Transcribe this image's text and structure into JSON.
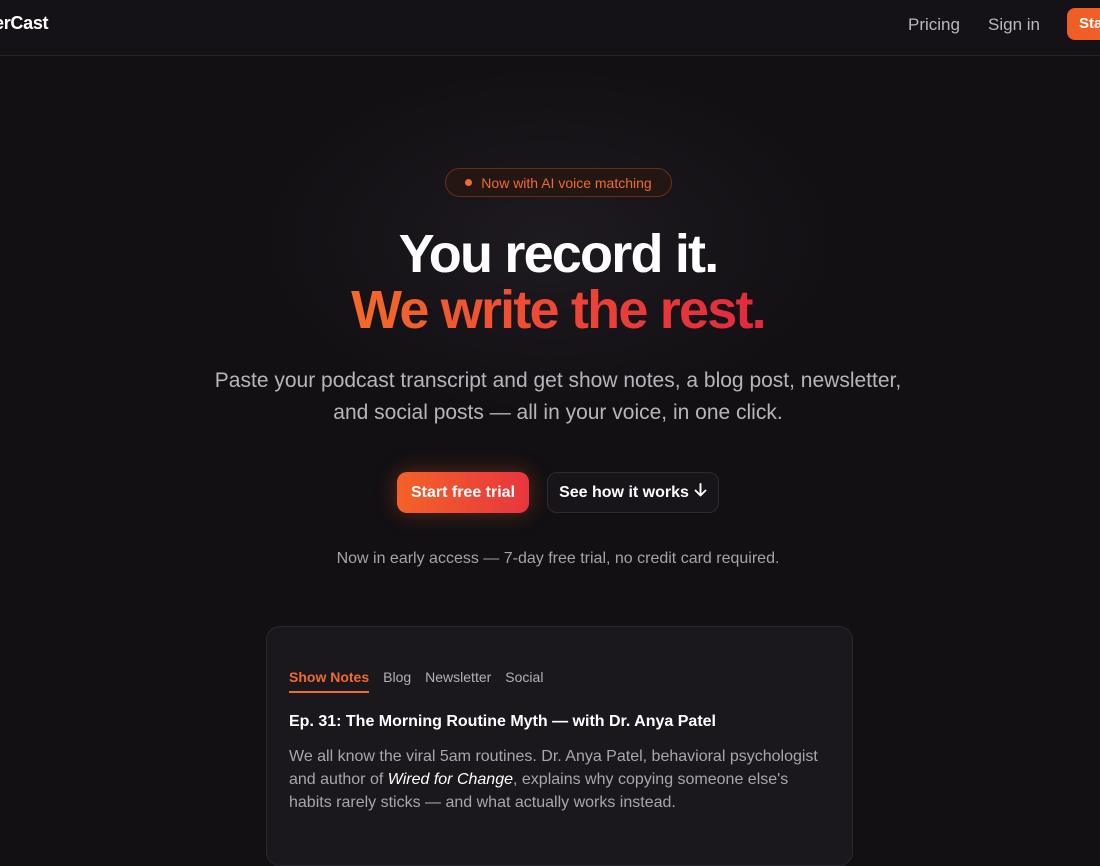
{
  "nav": {
    "logo": "erCast",
    "pricing": "Pricing",
    "sign_in": "Sign in",
    "cta": "Sta"
  },
  "hero": {
    "badge": "Now with AI voice matching",
    "headline_1": "You record it.",
    "headline_2": "We write the rest.",
    "subtitle": "Paste your podcast transcript and get show notes, a blog post, newsletter, and social posts — all in your voice, in one click.",
    "primary_cta": "Start free trial",
    "secondary_cta": "See how it works",
    "secondary_cta_icon": "arrow-down-icon",
    "note": "Now in early access — 7-day free trial, no credit card required."
  },
  "preview": {
    "tabs": [
      "Show Notes",
      "Blog",
      "Newsletter",
      "Social"
    ],
    "active_tab": "Show Notes",
    "episode_title": "Ep. 31: The Morning Routine Myth — with Dr. Anya Patel",
    "body_before": "We all know the viral 5am routines. Dr. Anya Patel, behavioral psychologist and author of ",
    "body_book": "Wired for Change",
    "body_after": ", explains why copying someone else's habits rarely sticks — and what actually works instead."
  },
  "colors": {
    "accent": "#f06b2e",
    "accent_end": "#e2283f",
    "background": "#121013"
  }
}
